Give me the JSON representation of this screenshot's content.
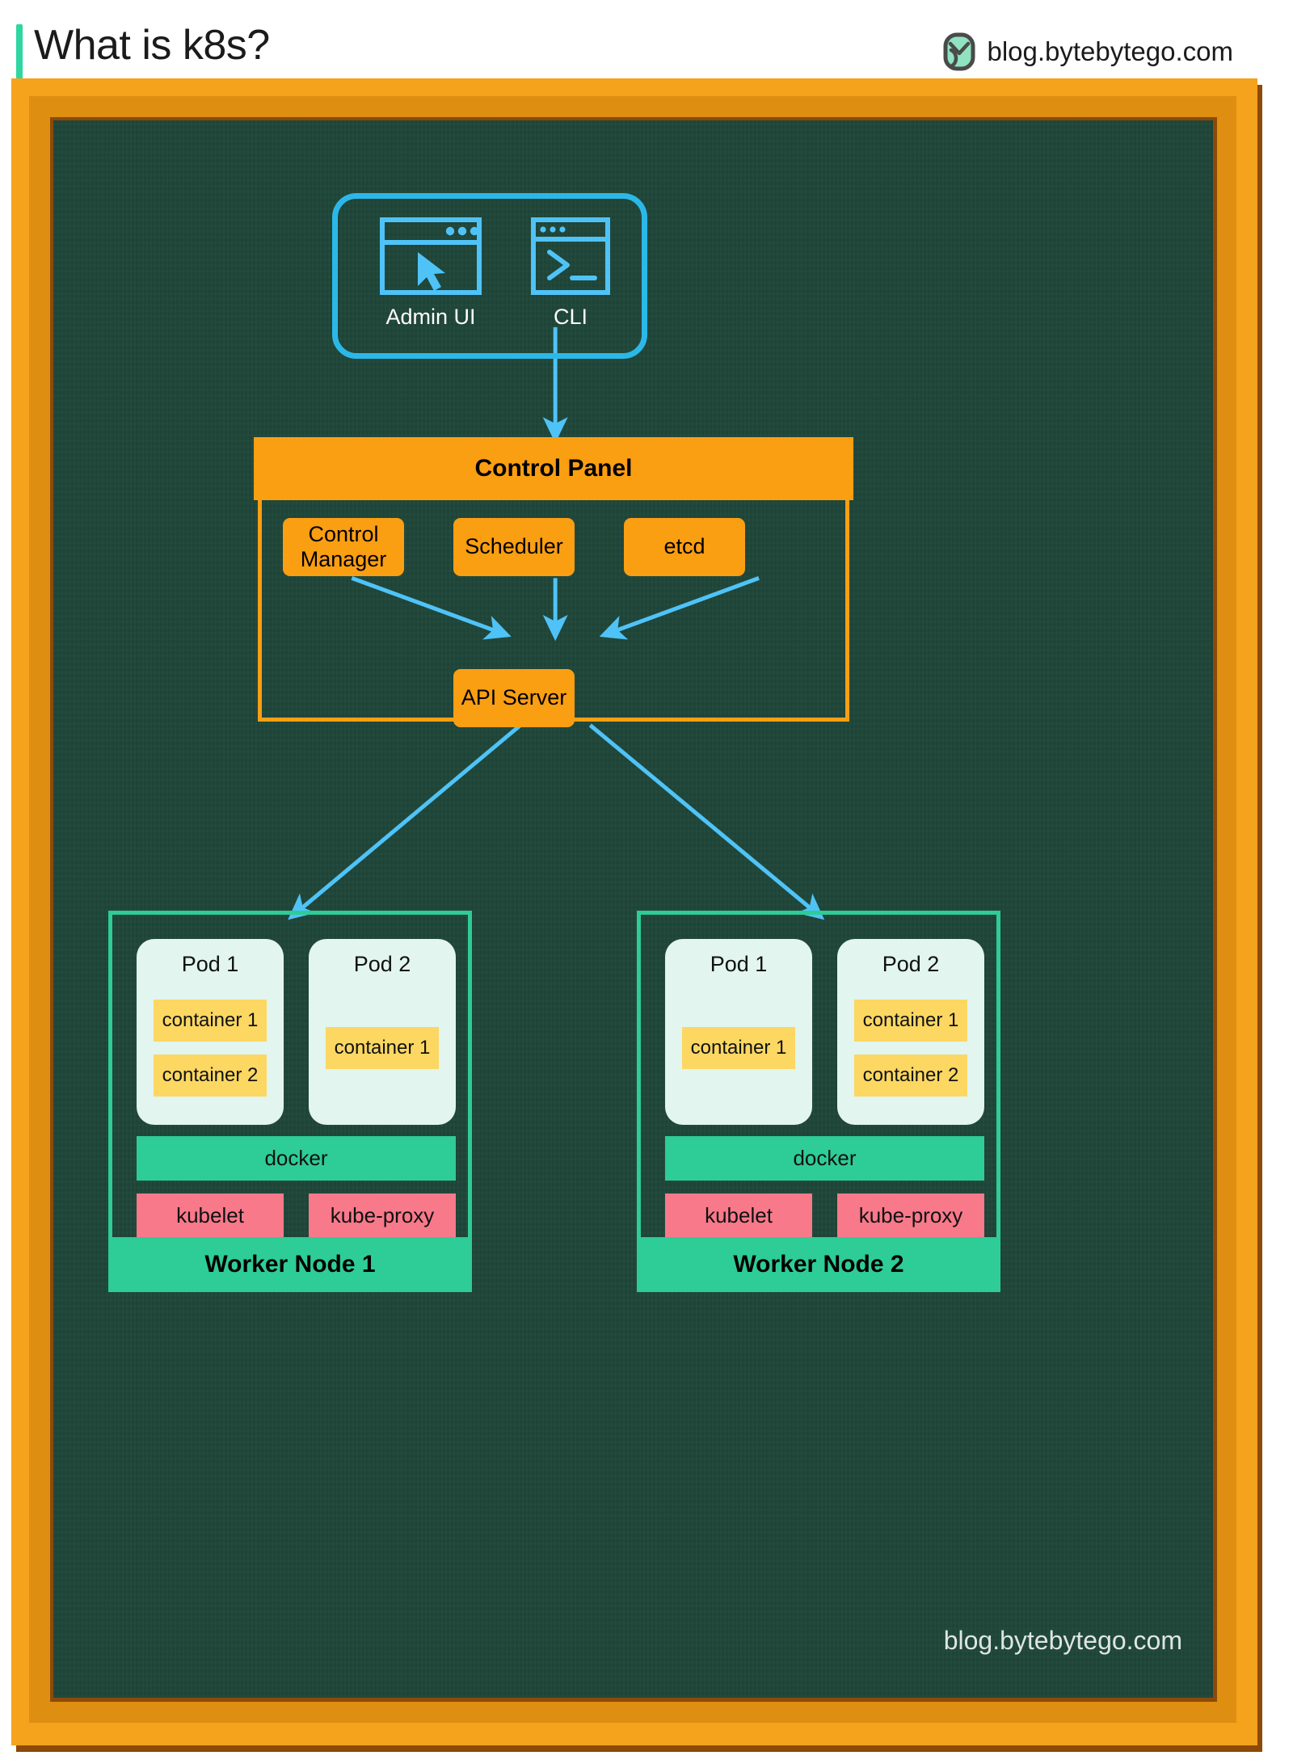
{
  "header": {
    "title": "What is k8s?",
    "brand_text": "blog.bytebytego.com",
    "logo_icon": "bytebytego-logo-icon",
    "accent_color": "#2ED6A0"
  },
  "colors": {
    "board_green": "#1F463A",
    "frame_orange": "#F5A21C",
    "frame_orange_dark": "#DE8E10",
    "frame_brown": "#8C4A08",
    "accent_blue": "#2BB8E8",
    "panel_orange": "#FA9E12",
    "node_teal": "#2ECC96",
    "pod_mint": "#E2F5EE",
    "container_yellow": "#FCD762",
    "service_pink": "#F7798A"
  },
  "clients": {
    "items": [
      {
        "label": "Admin UI",
        "icon": "browser-window-cursor-icon"
      },
      {
        "label": "CLI",
        "icon": "terminal-prompt-icon"
      }
    ]
  },
  "control_panel": {
    "title": "Control Panel",
    "components": [
      {
        "label": "Control\nManager",
        "line1": "Control",
        "line2": "Manager"
      },
      {
        "label": "Scheduler"
      },
      {
        "label": "etcd"
      }
    ],
    "api_server": {
      "label": "API Server"
    }
  },
  "worker_nodes": [
    {
      "title": "Worker Node 1",
      "pods": [
        {
          "title": "Pod 1",
          "containers": [
            "container 1",
            "container 2"
          ]
        },
        {
          "title": "Pod 2",
          "containers": [
            "container 1"
          ]
        }
      ],
      "runtime": {
        "label": "docker"
      },
      "services": [
        {
          "label": "kubelet"
        },
        {
          "label": "kube-proxy"
        }
      ]
    },
    {
      "title": "Worker Node 2",
      "pods": [
        {
          "title": "Pod 1",
          "containers": [
            "container 1"
          ]
        },
        {
          "title": "Pod 2",
          "containers": [
            "container 1",
            "container 2"
          ]
        }
      ],
      "runtime": {
        "label": "docker"
      },
      "services": [
        {
          "label": "kubelet"
        },
        {
          "label": "kube-proxy"
        }
      ]
    }
  ],
  "watermark": {
    "text": "blog.bytebytego.com"
  }
}
